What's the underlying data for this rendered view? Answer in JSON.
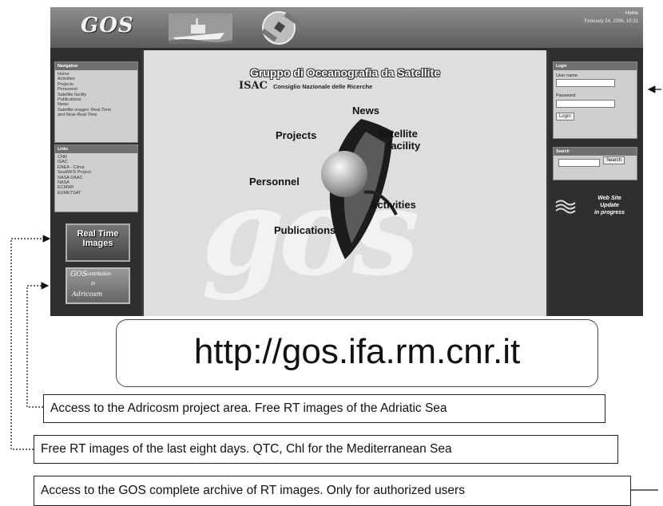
{
  "header": {
    "logo": "GOS",
    "logo_sub": "",
    "home_link": "Home",
    "datetime": "February 24, 2006, 15:31",
    "ship_icon": "ship-icon",
    "satellite_icon": "satellite-icon"
  },
  "navigation": {
    "title": "Navigation",
    "items": [
      "Home",
      "Activities",
      "Projects",
      "Personnel",
      "Satellite facility",
      "Publications",
      "News",
      "Satellite images: Real-Time",
      "and Near-Real-Time"
    ]
  },
  "links": {
    "title": "Links",
    "items": [
      "CNR",
      "ISAC",
      "ENEA - Clima",
      "SeaWiFS Project",
      "NASA DAAC",
      "NASA",
      "ECMWF",
      "EUMETSAT"
    ]
  },
  "banners": {
    "real_time_line1": "Real Time",
    "real_time_line2": "Images",
    "adricosm_gos": "GOS",
    "adricosm_contribution": "contribution",
    "adricosm_to": "to",
    "adricosm_name": "Adricosm"
  },
  "center": {
    "title": "Gruppo di Oceanografia da Satellite",
    "isac": "ISAC",
    "cnr": "Consiglio Nazionale delle Ricerche",
    "hub": {
      "news": "News",
      "projects": "Projects",
      "satellite": "Satellite",
      "facility": "facility",
      "personnel": "Personnel",
      "activities": "Activities",
      "publications": "Publications"
    }
  },
  "login": {
    "title": "Login",
    "username_label": "User name",
    "password_label": "Password",
    "button": "Login"
  },
  "search": {
    "title": "Search",
    "button": "Search"
  },
  "update_notice": {
    "line1": "Web Site",
    "line2": "Update",
    "line3": "in progress"
  },
  "url": "http://gos.ifa.rm.cnr.it",
  "callouts": {
    "adricosm": "Access to the Adricosm project area. Free RT images of the Adriatic Sea",
    "free_rt": "Free RT images of the last eight days. QTC, Chl for the Mediterranean Sea",
    "archive": "Access to the GOS complete archive of RT images. Only for authorized users"
  }
}
